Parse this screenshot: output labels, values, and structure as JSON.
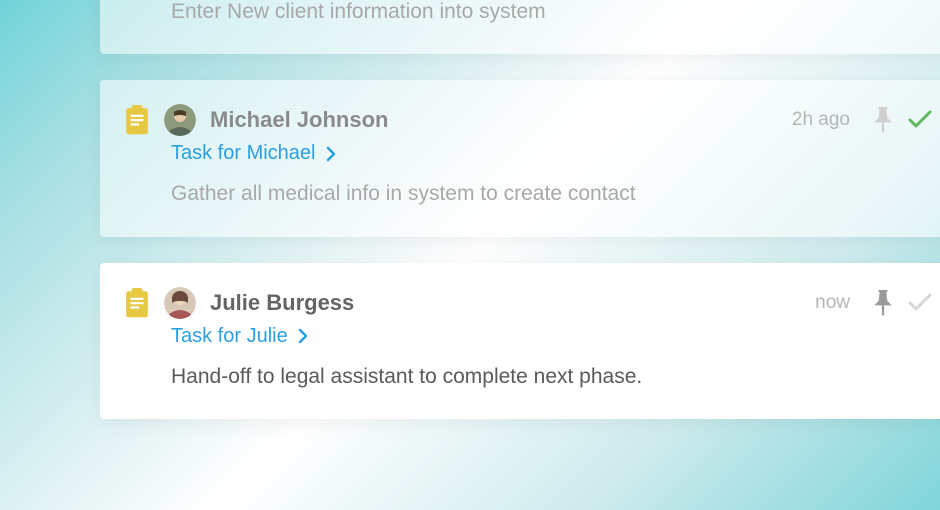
{
  "cards": [
    {
      "author": "",
      "task_link": "",
      "timestamp": "",
      "description": "Enter New client information into system",
      "checked": false,
      "pinned": false
    },
    {
      "author": "Michael Johnson",
      "task_link": "Task for Michael",
      "timestamp": "2h ago",
      "description": "Gather all medical info in system to create contact",
      "checked": true,
      "pinned": false
    },
    {
      "author": "Julie Burgess",
      "task_link": "Task for Julie",
      "timestamp": "now",
      "description": "Hand-off to legal assistant to complete next phase.",
      "checked": false,
      "pinned": true
    }
  ],
  "colors": {
    "accent_link": "#2b9fe0",
    "clipboard": "#e6c843",
    "check_done": "#5cb85c"
  }
}
